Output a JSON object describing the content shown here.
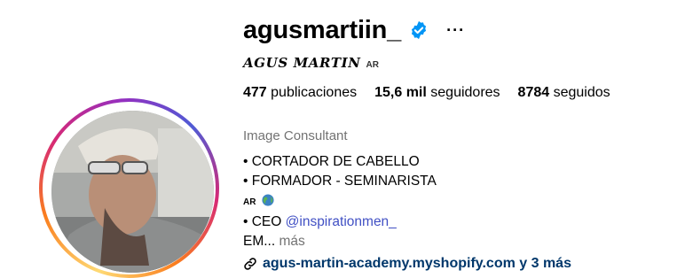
{
  "profile": {
    "username": "agusmartiin_",
    "more_label": "···",
    "full_name": "AGUS MARTIN",
    "full_name_flag": "AR"
  },
  "stats": {
    "posts_count": "477",
    "posts_label": "publicaciones",
    "followers_count": "15,6 mil",
    "followers_label": "seguidores",
    "following_count": "8784",
    "following_label": "seguidos"
  },
  "bio": {
    "category": "Image Consultant",
    "line1": "• CORTADOR DE CABELLO",
    "line2": "• FORMADOR - SEMINARISTA",
    "line3_flag": "AR",
    "line4_prefix": "• CEO ",
    "line4_mention": "@inspirationmen_",
    "line5": "EM...",
    "more": "más"
  },
  "link": {
    "text": "agus-martin-academy.myshopify.com y 3 más"
  },
  "icons": {
    "verified": "verified-badge-icon",
    "globe": "globe-icon",
    "link": "link-icon"
  },
  "colors": {
    "verified_blue": "#0095f6",
    "mention": "#4150c4",
    "link": "#00376b",
    "secondary_text": "#737373"
  }
}
